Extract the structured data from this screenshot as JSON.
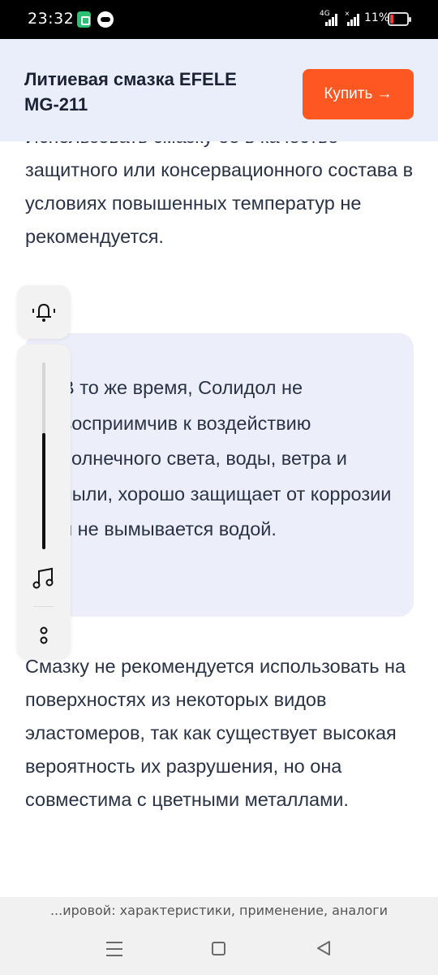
{
  "status_bar": {
    "time": "23:32",
    "network": "4G",
    "battery_percent": "11%",
    "icons": [
      "app-icon",
      "record-icon",
      "signal-icon",
      "no-signal-icon",
      "battery-low-icon"
    ]
  },
  "header": {
    "title": "Литиевая смазка EFELE MG-211",
    "buy_label": "Купить →",
    "buy_color": "#ff5722",
    "background": "#eaeefb"
  },
  "article": {
    "paragraph_1": "Использовать смазку ее в качестве защитного или консервационного состава в условиях повышенных температур не рекомендуется.",
    "quote": "В то же время, Солидол не восприимчив к воздействию солнечного света, воды, ветра и пыли, хорошо защищает от коррозии и не вымывается водой.",
    "paragraph_2": "Смазку не рекомендуется использовать на поверхностях из некоторых видов эластомеров, так как существует высокая вероятность их разрушения, но она совместима с цветными металлами."
  },
  "volume_overlay": {
    "level": 0.62,
    "icons": [
      "bell-icon",
      "music-note-icon",
      "more-dots-icon"
    ]
  },
  "browser": {
    "url_text": "...ировой: характеристики, применение, аналоги"
  },
  "nav": {
    "icons": [
      "menu-icon",
      "home-icon",
      "back-icon"
    ]
  }
}
